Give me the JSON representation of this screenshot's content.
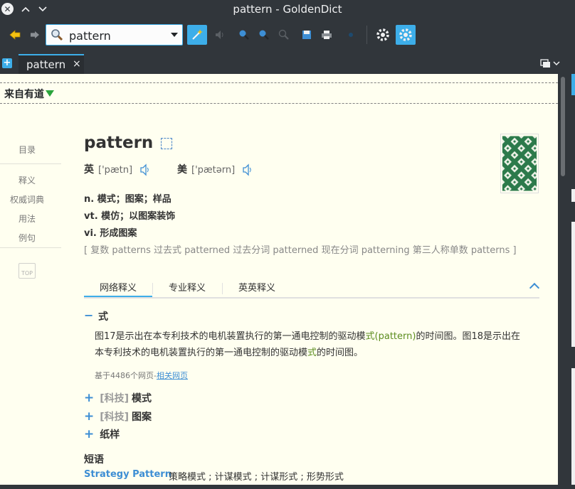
{
  "window": {
    "title": "pattern - GoldenDict"
  },
  "toolbar": {
    "search_value": "pattern",
    "accent": "#3daee9"
  },
  "tabs": [
    {
      "label": "pattern",
      "close": "×"
    }
  ],
  "dictionary": {
    "name": "来自有道"
  },
  "sidebar": {
    "items": [
      "目录",
      "释义",
      "权威词典",
      "用法",
      "例句"
    ],
    "top_label": "TOP"
  },
  "entry": {
    "word": "pattern",
    "pron_uk_label": "英",
    "pron_uk": "['pætn]",
    "pron_us_label": "美",
    "pron_us": "['pætərn]",
    "definitions": [
      "n. 模式；图案；样品",
      "vt. 模仿；以图案装饰",
      "vi. 形成图案"
    ],
    "inflections": "[ 复数 patterns 过去式 patterned 过去分词 patterned 现在分词 patterning 第三人称单数 patterns ]"
  },
  "section_tabs": [
    "网络释义",
    "专业释义",
    "英英释义"
  ],
  "web_def": {
    "title": "式",
    "para_before": "图17是示出在本专利技术的电机装置执行的第一通电控制的驱动模",
    "para_hl1": "式(pattern)",
    "para_mid": "的时间图。图18是示出在本专利技术的电机装置执行的第一通电控制的驱动模",
    "para_hl2": "式",
    "para_after": "的时间图。",
    "source_prefix": "基于4486个网页-",
    "source_link": "相关网页"
  },
  "more_defs": [
    {
      "tag": "[科技]",
      "text": "模式"
    },
    {
      "tag": "[科技]",
      "text": "图案"
    },
    {
      "tag": "",
      "text": "纸样"
    }
  ],
  "phrases": {
    "title": "短语",
    "items": [
      {
        "en": "Strategy Pattern",
        "zh": "策略模式 ; 计谋模式 ; 计谋形式 ; 形势形式"
      }
    ]
  }
}
